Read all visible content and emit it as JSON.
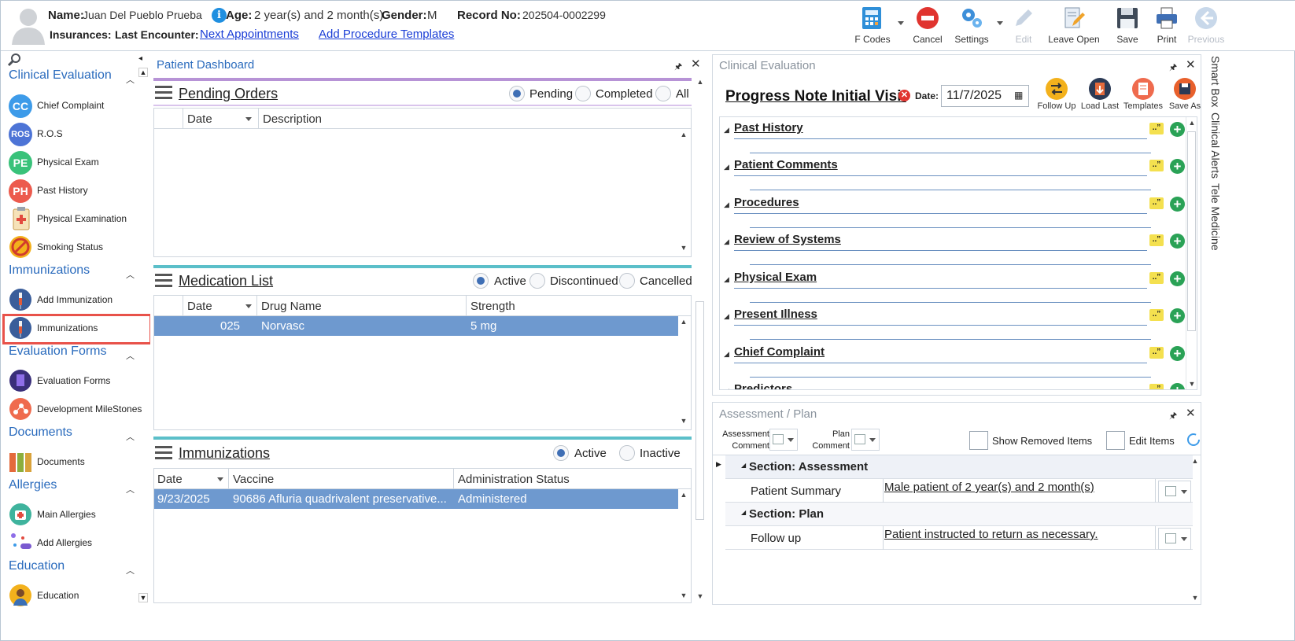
{
  "patient": {
    "name_label": "Name:",
    "name": "Juan Del Pueblo Prueba",
    "age_label": "Age:",
    "age": "2 year(s) and 2 month(s)",
    "gender_label": "Gender:",
    "gender": "M",
    "record_label": "Record No:",
    "record": "202504-0002299",
    "insurances_label": "Insurances:",
    "last_encounter_label": "Last Encounter:",
    "next_appointments": "Next Appointments",
    "add_procedure_templates": "Add Procedure Templates"
  },
  "toolbar": {
    "fcodes": "F Codes",
    "cancel": "Cancel",
    "settings": "Settings",
    "edit": "Edit",
    "leave_open": "Leave Open",
    "save": "Save",
    "print": "Print",
    "previous": "Previous"
  },
  "leftnav": {
    "sections": [
      {
        "title": "Clinical Evaluation",
        "items": [
          {
            "label": "Chief Complaint",
            "icon": "CC",
            "color": "#3d9be9"
          },
          {
            "label": "R.O.S",
            "icon": "ROS",
            "color": "#4d74d6"
          },
          {
            "label": "Physical Exam",
            "icon": "PE",
            "color": "#39c27a"
          },
          {
            "label": "Past History",
            "icon": "PH",
            "color": "#ec5b4e"
          },
          {
            "label": "Physical Examination",
            "icon": "clipboard-icon"
          },
          {
            "label": "Smoking Status",
            "icon": "no-smoking-icon"
          }
        ]
      },
      {
        "title": "Immunizations",
        "items": [
          {
            "label": "Add Immunization",
            "icon": "syringe-icon"
          },
          {
            "label": "Immunizations",
            "icon": "syringe-icon"
          }
        ]
      },
      {
        "title": "Evaluation Forms",
        "items": [
          {
            "label": "Evaluation Forms",
            "icon": "form-icon"
          },
          {
            "label": "Development MileStones",
            "icon": "milestone-icon"
          }
        ]
      },
      {
        "title": "Documents",
        "items": [
          {
            "label": "Documents",
            "icon": "binders-icon"
          }
        ]
      },
      {
        "title": "Allergies",
        "items": [
          {
            "label": "Main Allergies",
            "icon": "medkit-icon"
          },
          {
            "label": "Add Allergies",
            "icon": "pills-icon"
          }
        ]
      },
      {
        "title": "Education",
        "items": [
          {
            "label": "Education",
            "icon": "student-icon"
          }
        ]
      }
    ]
  },
  "dashboard": {
    "title": "Patient Dashboard",
    "pending": {
      "title": "Pending Orders",
      "radios": [
        "Pending",
        "Completed",
        "All"
      ],
      "columns": [
        "Date",
        "Description"
      ]
    },
    "medication": {
      "title": "Medication List",
      "radios": [
        "Active",
        "Discontinued",
        "Cancelled"
      ],
      "columns": [
        "Date",
        "Drug Name",
        "Strength"
      ],
      "rows": [
        {
          "date": "025",
          "drug": "Norvasc",
          "strength": "5 mg"
        }
      ]
    },
    "immunizations": {
      "title": "Immunizations",
      "radios": [
        "Active",
        "Inactive"
      ],
      "columns": [
        "Date",
        "Vaccine",
        "Administration Status"
      ],
      "rows": [
        {
          "date": "9/23/2025",
          "vaccine": "90686 Afluria quadrivalent preservative...",
          "status": "Administered"
        }
      ]
    }
  },
  "clinical": {
    "title": "Clinical Evaluation",
    "note_title": "Progress Note Initial Visit",
    "date_label": "Date:",
    "date": "11/7/2025",
    "actions": [
      "Follow Up",
      "Load Last",
      "Templates",
      "Save As"
    ],
    "sections": [
      "Past History",
      "Patient Comments",
      "Procedures",
      "Review of Systems",
      "Physical Exam",
      "Present Illness",
      "Chief Complaint",
      "Predictors"
    ]
  },
  "assessment": {
    "title": "Assessment / Plan",
    "assessment_comment": "Assessment Comment",
    "plan_comment": "Plan Comment",
    "show_removed": "Show Removed Items",
    "edit_items": "Edit Items",
    "section_assessment": "Section: Assessment",
    "patient_summary_label": "Patient Summary",
    "patient_summary": "Male patient of 2 year(s) and 2 month(s)",
    "section_plan": "Section: Plan",
    "follow_up_label": "Follow up",
    "follow_up": "Patient instructed to return as necessary."
  },
  "right_tabs": [
    "Smart Box",
    "Clinical Alerts",
    "Tele Medicine"
  ],
  "colors": {
    "accent_blue": "#2a6bbd",
    "selected_row": "#6e99cf",
    "highlight_red": "#e8524a",
    "purple_band": "#b793d6",
    "teal_band": "#5bbfc9"
  }
}
